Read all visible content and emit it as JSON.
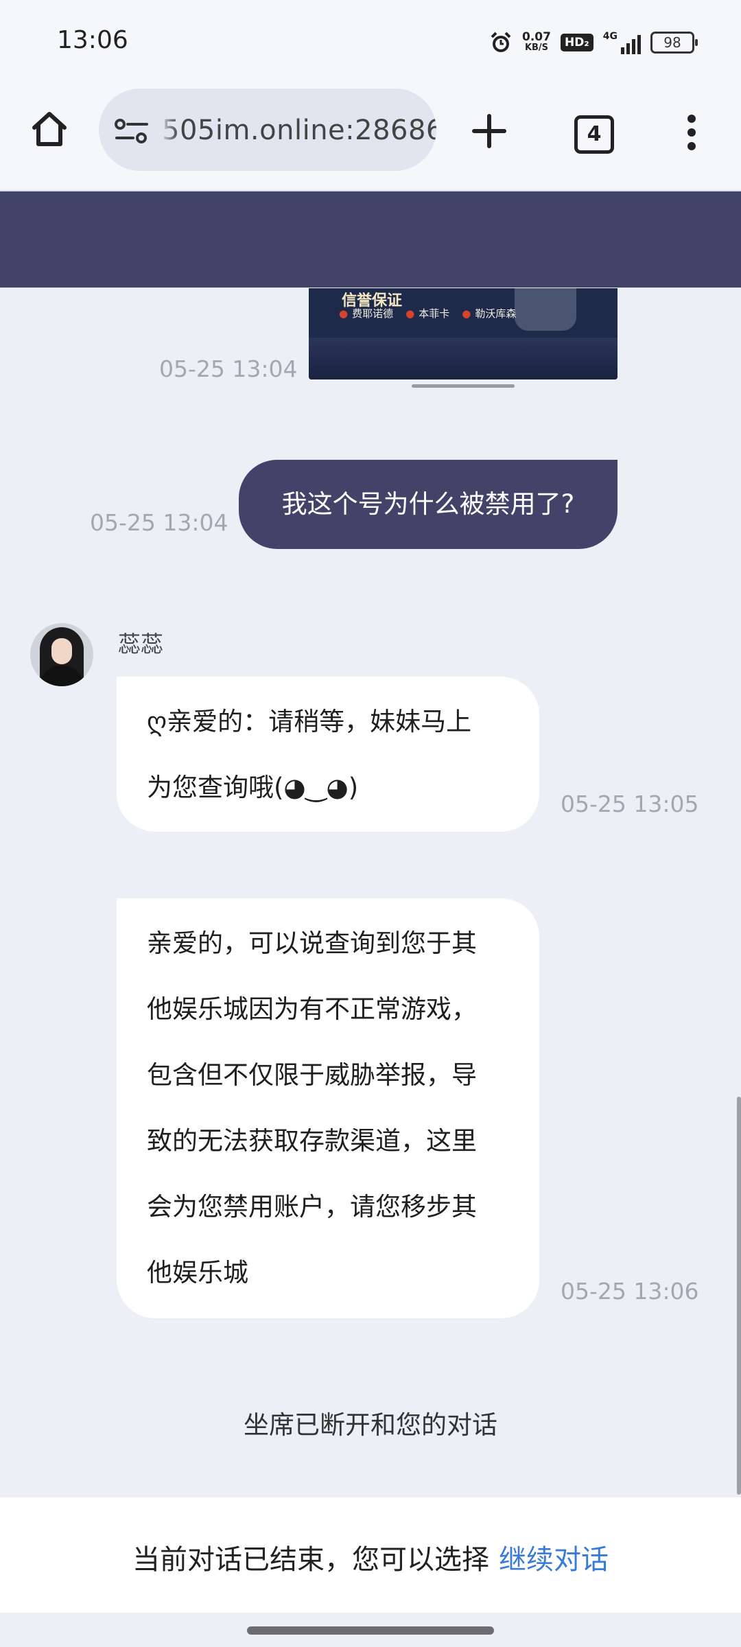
{
  "status_bar": {
    "time": "13:06",
    "net_speed": "0.07",
    "net_unit": "KB/S",
    "hd_badge": "HD₂",
    "signal": "4G",
    "battery": "98"
  },
  "browser": {
    "url": "505im.online:28686",
    "tab_count": "4"
  },
  "chat": {
    "image_message": {
      "banner_text": "信誉保证",
      "team_1": "费耶诺德",
      "team_2": "本菲卡",
      "team_3": "勒沃库森",
      "timestamp": "05-25 13:04"
    },
    "user_message": {
      "text": "我这个号为什么被禁用了?",
      "timestamp": "05-25 13:04"
    },
    "agent_name": "蕊蕊",
    "agent_message_1": {
      "lines": [
        "ღ亲爱的：请稍等，妹妹马上",
        "为您查询哦(◕‿◕)"
      ],
      "timestamp": "05-25 13:05"
    },
    "agent_message_2": {
      "lines": [
        "亲爱的，可以说查询到您于其",
        "他娱乐城因为有不正常游戏，",
        "包含但不仅限于威胁举报，导",
        "致的无法获取存款渠道，这里",
        "会为您禁用账户，请您移步其",
        "他娱乐城"
      ],
      "timestamp": "05-25 13:06"
    },
    "system_notice": "坐席已断开和您的对话"
  },
  "footer": {
    "text": "当前对话已结束，您可以选择",
    "link": "继续对话"
  },
  "colors": {
    "header": "#414368",
    "user_bubble": "#414368",
    "link": "#3a7bd5",
    "background": "#edeff7"
  }
}
